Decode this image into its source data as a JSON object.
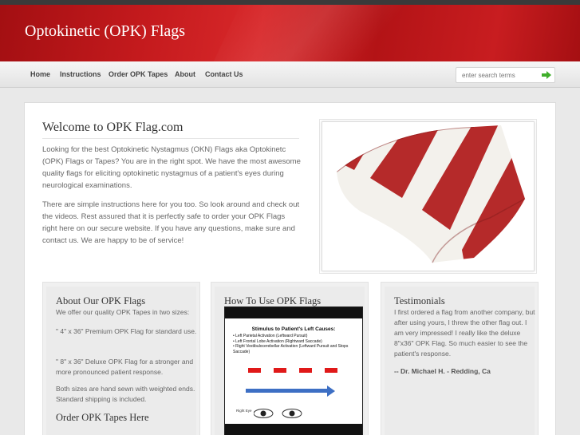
{
  "header": {
    "site_title": "Optokinetic (OPK) Flags"
  },
  "nav": {
    "items": [
      {
        "label": "Home"
      },
      {
        "label": "Instructions"
      },
      {
        "label": "Order OPK Tapes"
      },
      {
        "label": "About"
      },
      {
        "label": "Contact Us"
      }
    ]
  },
  "search": {
    "placeholder": "enter search terms"
  },
  "welcome": {
    "title": "Welcome to OPK Flag.com",
    "para1": "Looking for the best Optokinetic Nystagmus (OKN) Flags aka Optokinetc (OPK) Flags or Tapes? You are in the right spot. We have the most awesome quality flags for eliciting optokinetic nystagmus of a patient's eyes during neurological examinations.",
    "para2": "There are simple instructions here for you too. So look around and check out the videos. Rest assured that it is perfectly safe to order your OPK Flags right here on our secure website. If you have any questions, make sure and contact us. We are happy to be of service!"
  },
  "about_box": {
    "title": "About Our OPK Flags",
    "line1": "We offer our quality OPK Tapes in two sizes:",
    "line2": "\" 4\" x 36\" Premium OPK Flag for standard use.",
    "line3": "\" 8\" x 36\" Deluxe OPK Flag for a stronger and more pronounced patient response.",
    "line4": "Both sizes are hand sewn with weighted ends. Standard shipping is included.",
    "order_title": "Order OPK Tapes Here"
  },
  "howto_box": {
    "title": "How To Use OPK Flags",
    "video": {
      "stim_title": "Stimulus to Patient's Left Causes:",
      "items": [
        "Left Parietal Activation (Leftward Pursuit)",
        "Left Frontal Lobe Activation (Rightward Saccade)",
        "Right Vestibulocerebellar Activation (Leftward Pursuit and Stops Saccade)"
      ],
      "eye_label": "Right Eye"
    }
  },
  "testimonials_box": {
    "title": "Testimonials",
    "quote": "I first ordered a flag from another company, but after using yours, I threw the other flag out. I am very impressed! I really like the deluxe 8\"x36\" OPK Flag. So much easier to see the patient's response.",
    "credit": "-- Dr. Michael H. - Redding, Ca"
  },
  "colors": {
    "header_red": "#c41a1d",
    "flag_red": "#b52a2a",
    "search_arrow": "#3fae2a",
    "video_arrow": "#3d6fc4",
    "stim_red": "#e01919"
  },
  "icons": {
    "search_button": "green-arrow-icon"
  }
}
